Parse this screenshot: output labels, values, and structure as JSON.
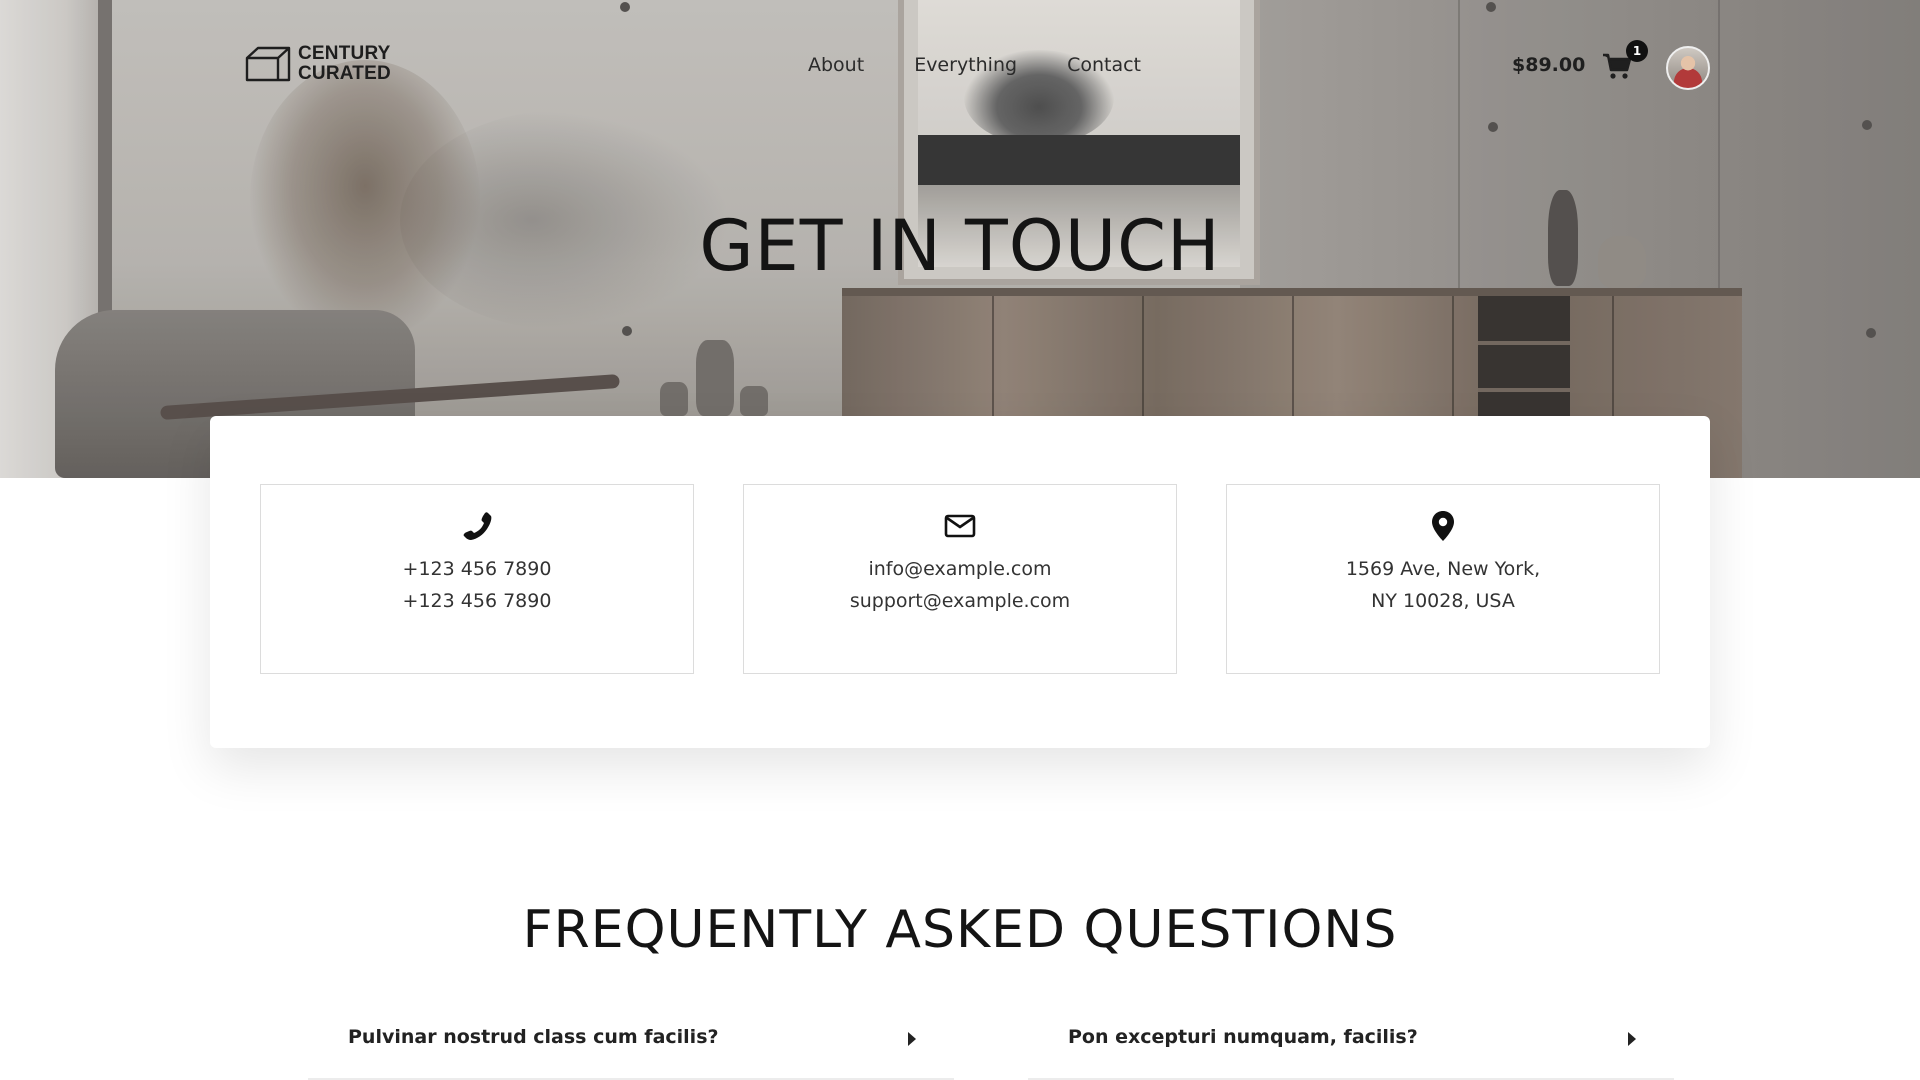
{
  "brand": {
    "line1": "CENTURY",
    "line2": "CURATED"
  },
  "nav": {
    "items": [
      "About",
      "Everything",
      "Contact"
    ]
  },
  "cart": {
    "total": "$89.00",
    "count": "1"
  },
  "hero": {
    "title": "GET IN TOUCH"
  },
  "contact": {
    "phone": {
      "icon": "phone-icon",
      "lines": [
        "+123 456 7890",
        "+123 456 7890"
      ]
    },
    "email": {
      "icon": "envelope-icon",
      "lines": [
        "info@example.com",
        "support@example.com"
      ]
    },
    "address": {
      "icon": "map-pin-icon",
      "lines": [
        "1569 Ave, New York,",
        "NY 10028, USA"
      ]
    }
  },
  "faq": {
    "title": "FREQUENTLY ASKED QUESTIONS",
    "items": [
      {
        "question": "Pulvinar nostrud class cum facilis?"
      },
      {
        "question": "Pon excepturi numquam, facilis?"
      }
    ]
  }
}
